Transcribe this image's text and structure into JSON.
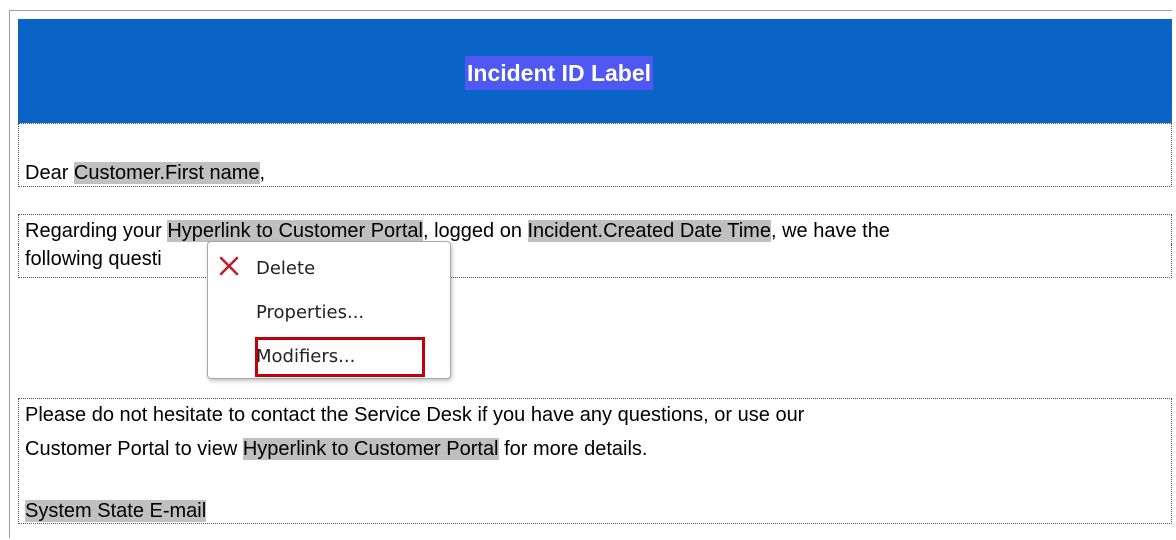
{
  "header": {
    "title": "Incident ID Label"
  },
  "greeting": {
    "prefix": "Dear ",
    "field": "Customer.First name",
    "suffix": ","
  },
  "paragraph1": {
    "text1": "Regarding your ",
    "field1": "Hyperlink to Customer Portal",
    "text2": ", logged on ",
    "field2": "Incident.Created Date Time",
    "text3": ", we have the",
    "line2": "following questi"
  },
  "context_menu": {
    "items": [
      {
        "label": "Delete",
        "icon": "delete-x-icon"
      },
      {
        "label": "Properties..."
      },
      {
        "label": "Modifiers..."
      }
    ]
  },
  "paragraph2": {
    "line1": "Please do not hesitate to contact the Service Desk if you have any questions, or use our",
    "line2_prefix": "Customer Portal to view ",
    "line2_field": "Hyperlink to Customer Portal",
    "line2_suffix": " for more details.",
    "signature_field": "System State E-mail"
  },
  "colors": {
    "header_bg": "#0a64c8",
    "field_bg": "#c0c0c0",
    "highlight": "#c0000b",
    "delete_icon": "#c0202a"
  }
}
